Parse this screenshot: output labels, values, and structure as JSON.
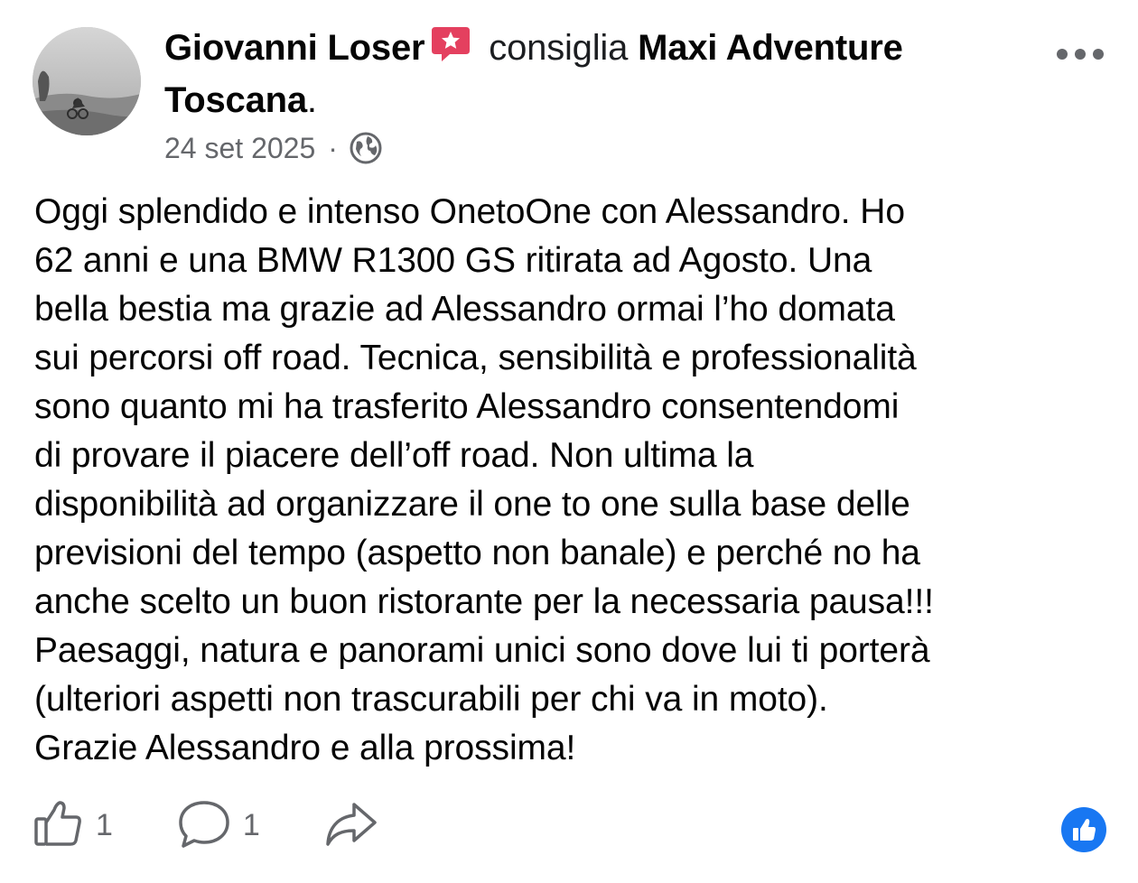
{
  "post": {
    "author": "Giovanni Loser",
    "verb": "consiglia",
    "page_name": "Maxi Adventure Toscana",
    "period": ".",
    "date": "24 set 2025",
    "separator": "·",
    "audience_icon": "globe-icon",
    "author_badge_icon": "recommendation-star-icon",
    "body_lines": [
      "Oggi splendido e intenso OnetoOne con Alessandro. Ho",
      "62 anni e una BMW R1300 GS ritirata ad Agosto. Una",
      "bella bestia ma grazie ad Alessandro ormai l’ho domata",
      "sui percorsi off road. Tecnica, sensibilità e professionalità",
      "sono quanto mi ha trasferito Alessandro consentendomi",
      "di provare il piacere dell’off road. Non ultima la",
      "disponibilità ad organizzare il one to one sulla base delle",
      "previsioni del tempo (aspetto non banale) e perché no ha",
      "anche scelto un buon ristorante per la necessaria pausa!!!",
      "Paesaggi, natura e panorami unici sono dove lui ti porterà",
      "(ulteriori aspetti non trascurabili per chi va in moto).",
      "Grazie Alessandro e alla prossima!"
    ]
  },
  "actions": {
    "like_count": "1",
    "comment_count": "1",
    "like_icon": "thumbs-up-icon",
    "comment_icon": "comment-bubble-icon",
    "share_icon": "share-arrow-icon",
    "reaction_icon": "like-reaction-icon"
  },
  "colors": {
    "badge": "#e4405f",
    "reaction": "#1877f2",
    "secondary_text": "#65676b",
    "primary_text": "#050505"
  }
}
